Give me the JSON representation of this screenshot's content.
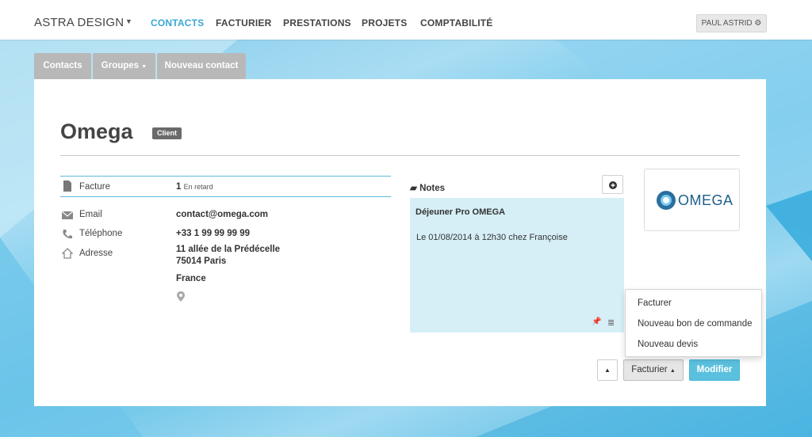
{
  "nav": {
    "brand": "ASTRA DESIGN",
    "items": [
      "CONTACTS",
      "FACTURIER",
      "PRESTATIONS",
      "PROJETS",
      "COMPTABILITÉ"
    ],
    "active": "CONTACTS",
    "user": "PAUL ASTRID"
  },
  "subtabs": [
    "Contacts",
    "Groupes",
    "Nouveau contact"
  ],
  "contact": {
    "name": "Omega",
    "badge": "Client",
    "facture_label": "Facture",
    "facture_count": "1",
    "facture_status": "En retard",
    "email_label": "Email",
    "email": "contact@omega.com",
    "phone_label": "Téléphone",
    "phone": "+33 1 99 99 99 99",
    "address_label": "Adresse",
    "address_line1": "11 allée de la Prédécelle",
    "address_line2": "75014 Paris",
    "country": "France"
  },
  "notes": {
    "heading": "Notes",
    "title": "Déjeuner Pro OMEGA",
    "body": "Le 01/08/2014 à 12h30 chez Françoise"
  },
  "logo": {
    "text": "OMEGA"
  },
  "dropdown": [
    "Facturer",
    "Nouveau bon de commande",
    "Nouveau devis"
  ],
  "actions": {
    "facturier": "Facturier",
    "modifier": "Modifier"
  },
  "colors": {
    "accent": "#5bc0de",
    "nav_active": "#3ba6d6",
    "note_bg": "#d6eff7"
  }
}
